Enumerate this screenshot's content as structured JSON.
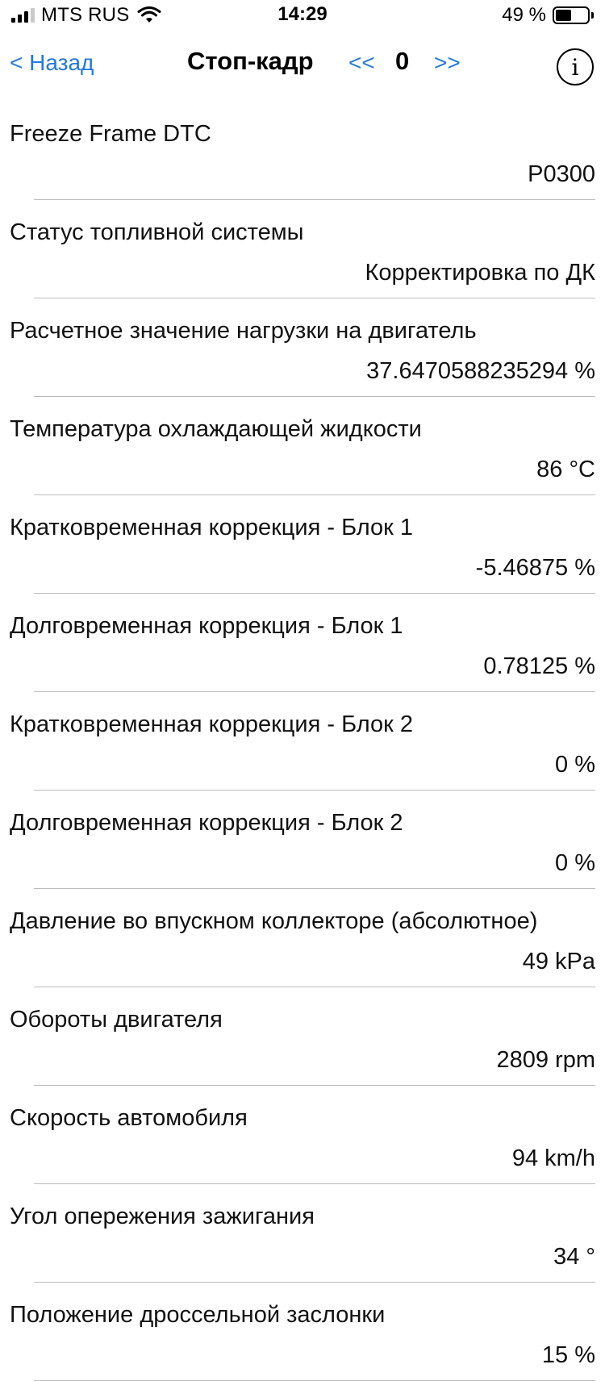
{
  "status_bar": {
    "carrier": "MTS RUS",
    "time": "14:29",
    "battery_percent_label": "49 %",
    "battery_level": 0.49
  },
  "nav": {
    "back_label": "< Назад",
    "title": "Стоп-кадр",
    "prev_label": "<<",
    "frame_index": "0",
    "next_label": ">>",
    "info_label": "i"
  },
  "rows": [
    {
      "label": "Freeze Frame DTC",
      "value": "P0300 "
    },
    {
      "label": "Статус топливной системы",
      "value": "Корректировка по ДК "
    },
    {
      "label": "Расчетное значение нагрузки на двигатель",
      "value": "37.6470588235294 %"
    },
    {
      "label": "Температура охлаждающей жидкости",
      "value": "86 °C"
    },
    {
      "label": "Кратковременная коррекция - Блок 1",
      "value": "-5.46875 %"
    },
    {
      "label": "Долговременная коррекция - Блок 1",
      "value": "0.78125 %"
    },
    {
      "label": "Кратковременная коррекция - Блок 2",
      "value": "0 %"
    },
    {
      "label": "Долговременная коррекция - Блок 2",
      "value": "0 %"
    },
    {
      "label": "Давление во впускном коллекторе (абсолютное)",
      "value": "49 kPa"
    },
    {
      "label": "Обороты двигателя",
      "value": "2809 rpm"
    },
    {
      "label": "Скорость автомобиля",
      "value": "94 km/h"
    },
    {
      "label": "Угол опережения зажигания",
      "value": "34 °"
    },
    {
      "label": "Положение дроссельной заслонки",
      "value": "15 %"
    }
  ]
}
